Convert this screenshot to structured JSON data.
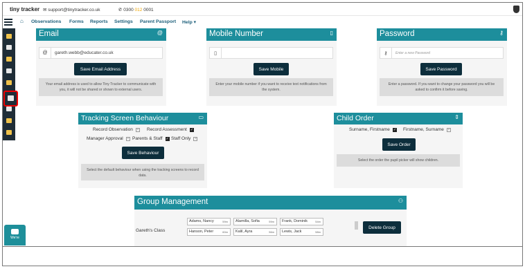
{
  "topbar": {
    "logo": "tiny tracker",
    "email": "support@tinytracker.co.uk",
    "phone_prefix": "0300 ",
    "phone_mid": "012",
    "phone_suffix": " 0001"
  },
  "nav": {
    "items": [
      "Observations",
      "Forms",
      "Reports",
      "Settings",
      "Parent Passport",
      "Help ▾"
    ]
  },
  "email_card": {
    "title": "Email",
    "prefix": "@",
    "value": "gareth.webb@educater.co.uk",
    "button": "Save Email Address",
    "note": "Your email address is used to allow Tiny Tracker to communicate with you, it will not be shared or shown to external users."
  },
  "mobile_card": {
    "title": "Mobile Number",
    "value": "",
    "button": "Save Mobile",
    "note": "Enter your mobile number if you want to receive text notifications from the system."
  },
  "password_card": {
    "title": "Password",
    "placeholder": "Enter a new Password",
    "button": "Save Password",
    "note": "Enter a password. If you want to change your password you will be asked to confirm it before saving."
  },
  "tracking_card": {
    "title": "Tracking Screen Behaviour",
    "options": {
      "record_observation": "Record Observation",
      "record_assessment": "Record Assessment",
      "manager_approval": "Manager Approval",
      "parents_staff": "Parents & Staff",
      "staff_only": "Staff Only"
    },
    "button": "Save Behaviour",
    "note": "Select the default behaviour when using the tracking screens to record data."
  },
  "child_order_card": {
    "title": "Child Order",
    "options": {
      "surname_first": "Surname, Firstname",
      "first_surname": "Firstname, Surname"
    },
    "button": "Save Order",
    "note": "Select the order the pupil picker will show children."
  },
  "group_card": {
    "title": "Group Management",
    "class_label": "Gareth's Class",
    "children": [
      {
        "name": "Adams, Nancy",
        "age": "59m"
      },
      {
        "name": "Alamilla, Sofia",
        "age": "59m"
      },
      {
        "name": "Frank, Dominik",
        "age": "54m"
      },
      {
        "name": "Hanson, Peter",
        "age": "60m"
      },
      {
        "name": "Kalil, Ayra",
        "age": "56m"
      },
      {
        "name": "Lewis, Jack",
        "age": "58m"
      }
    ],
    "delete_button": "Delete Group"
  },
  "chat": {
    "label": "We're"
  },
  "colors": {
    "header": "#1d8e9c",
    "button": "#0d2e3c",
    "sidebar": "#1f2d37",
    "highlight": "#ee0000"
  }
}
